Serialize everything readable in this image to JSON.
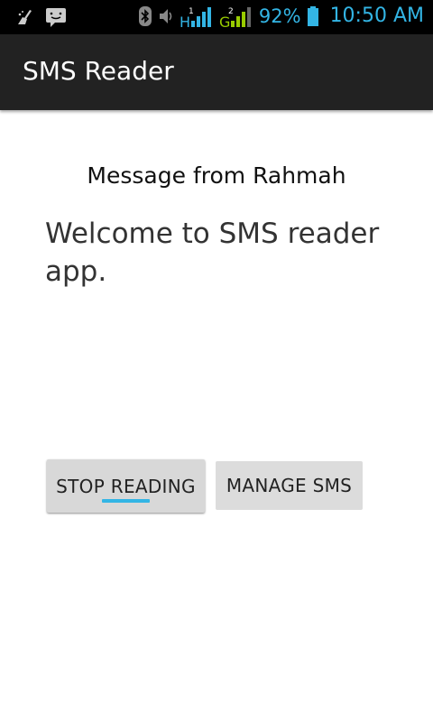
{
  "status_bar": {
    "battery_percent": "92%",
    "time": "10:50 AM",
    "signal_1_label": "H",
    "signal_2_label": "G",
    "icons": [
      "cleaner-icon",
      "message-notification-icon",
      "bluetooth-icon",
      "volume-icon",
      "signal-sim1-icon",
      "signal-sim2-icon",
      "battery-icon"
    ],
    "accent_color": "#33b5e5"
  },
  "action_bar": {
    "title": "SMS Reader"
  },
  "content": {
    "message_header": "Message from Rahmah",
    "message_body": "Welcome to SMS reader app."
  },
  "buttons": {
    "stop_reading": "STOP READING",
    "manage_sms": "MANAGE SMS"
  }
}
